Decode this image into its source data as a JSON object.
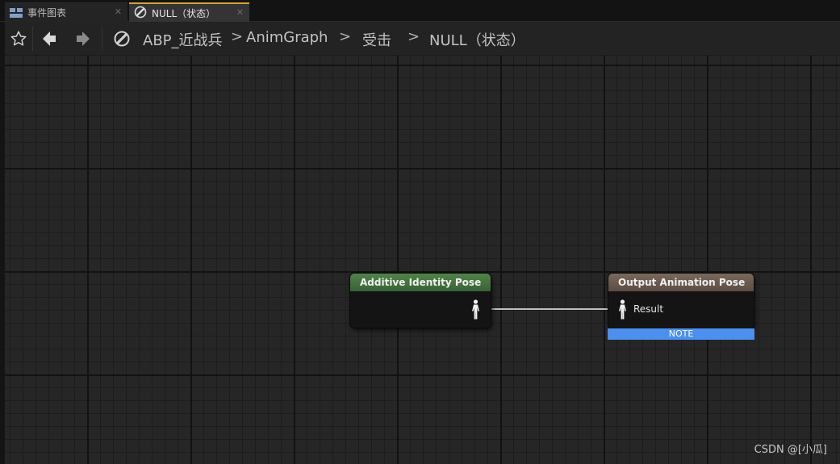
{
  "tabs": [
    {
      "label": "事件图表",
      "icon": "event-graph-icon",
      "active": false
    },
    {
      "label": "NULL（状态）",
      "icon": "state-icon",
      "active": true
    }
  ],
  "breadcrumb": {
    "items": [
      "ABP_近战兵",
      "AnimGraph",
      "受击",
      "NULL（状态）"
    ],
    "separator": ">"
  },
  "nodes": {
    "additive": {
      "title": "Additive Identity Pose",
      "header_color": "#3e6a38",
      "icon": "pose-figure-icon"
    },
    "output": {
      "title": "Output Animation Pose",
      "header_color": "#6b5a50",
      "pin_label": "Result",
      "note": "NOTE",
      "icon": "pose-figure-icon"
    }
  },
  "watermark": "CSDN @[小瓜]",
  "colors": {
    "accent_tab": "#d8a424",
    "note": "#4a90f0",
    "wire": "#bfbfbf"
  }
}
